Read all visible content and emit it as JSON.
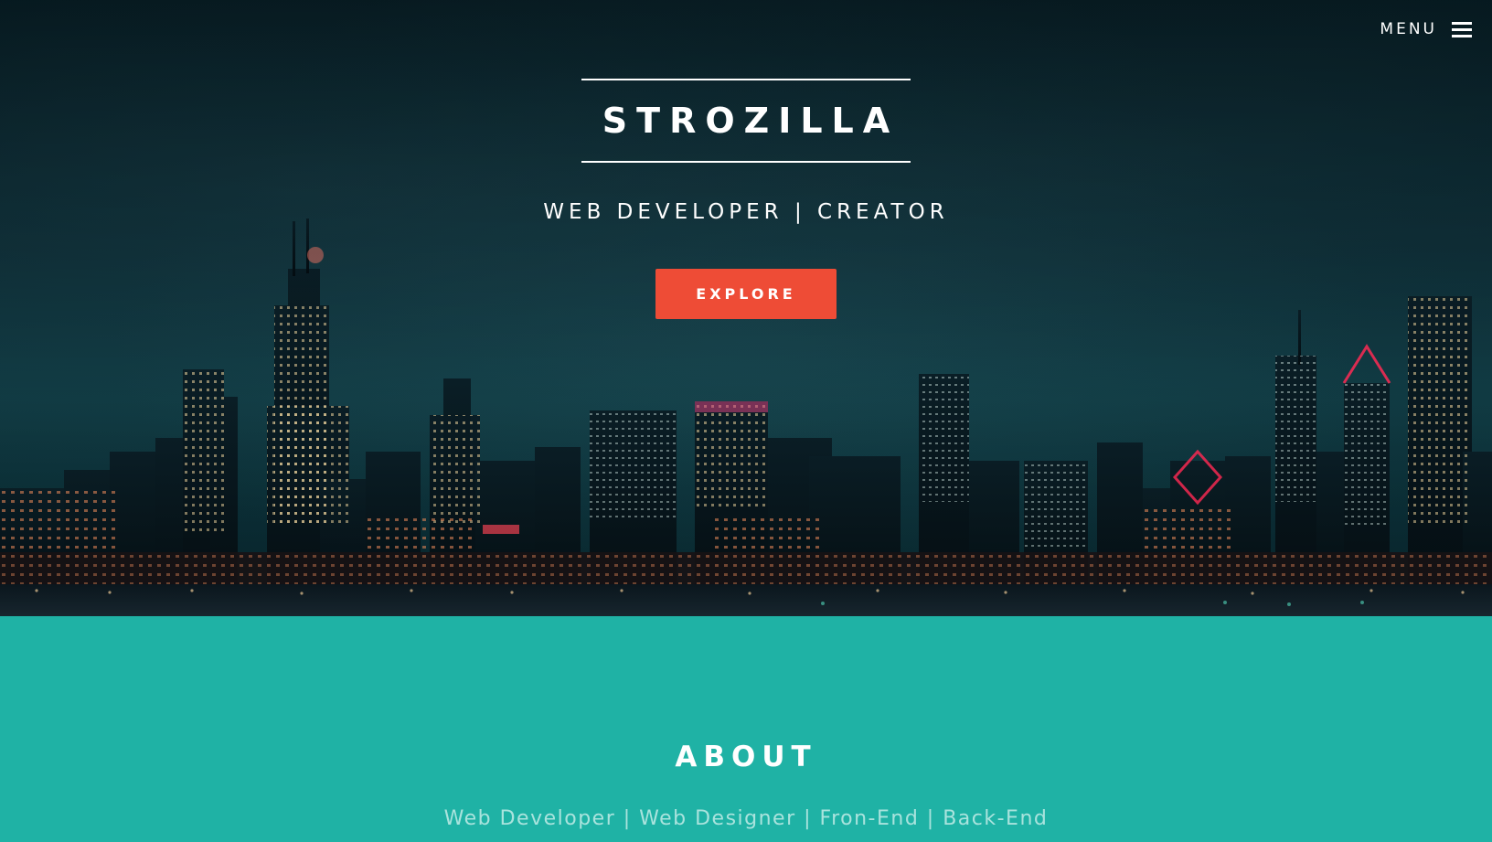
{
  "nav": {
    "menu_label": "MENU"
  },
  "hero": {
    "title": "STROZILLA",
    "tagline": "WEB DEVELOPER | CREATOR",
    "explore_label": "EXPLORE"
  },
  "about": {
    "title": "ABOUT",
    "subtitle": "Web Developer | Web Designer | Fron-End | Back-End"
  },
  "colors": {
    "accent_button": "#ee4c36",
    "about_background": "#1fb2a5",
    "about_subtitle_text": "#a9e3dd",
    "hero_background": "#0b2a33"
  },
  "icons": {
    "menu": "hamburger-menu-icon"
  }
}
